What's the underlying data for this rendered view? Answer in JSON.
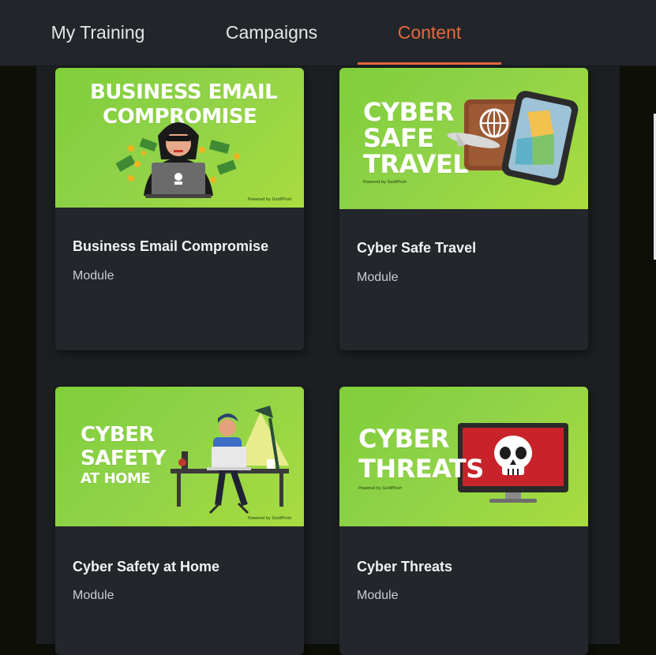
{
  "nav": {
    "tabs": [
      {
        "label": "My Training",
        "active": false
      },
      {
        "label": "Campaigns",
        "active": false
      },
      {
        "label": "Content",
        "active": true
      }
    ],
    "accent_color": "#e4683f"
  },
  "cards": [
    {
      "title": "Business Email Compromise",
      "type": "Module",
      "banner_lines": [
        "BUSINESS EMAIL",
        "COMPROMISE"
      ],
      "powered_by": "Powered by GoldPhish",
      "illustration": "hacker-laptop-money"
    },
    {
      "title": "Cyber Safe Travel",
      "type": "Module",
      "banner_lines": [
        "CYBER",
        "SAFE",
        "TRAVEL"
      ],
      "powered_by": "Powered by GoldPhish",
      "illustration": "passport-phone-map"
    },
    {
      "title": "Cyber Safety at Home",
      "type": "Module",
      "banner_lines": [
        "CYBER",
        "SAFETY",
        "AT HOME"
      ],
      "powered_by": "Powered by GoldPhish",
      "illustration": "person-at-desk"
    },
    {
      "title": "Cyber Threats",
      "type": "Module",
      "banner_lines": [
        "CYBER",
        "THREATS"
      ],
      "powered_by": "Powered by GoldPhish",
      "illustration": "monitor-skull"
    }
  ]
}
